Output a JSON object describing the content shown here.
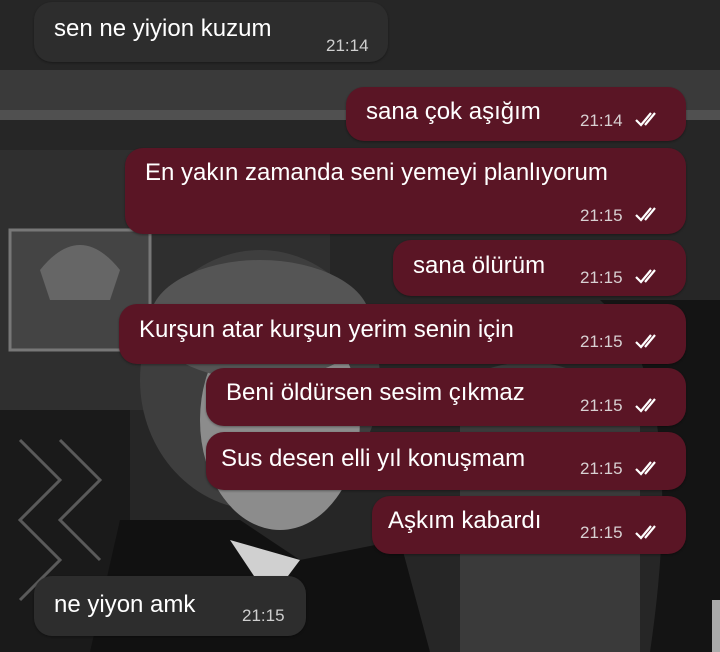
{
  "messages": [
    {
      "direction": "incoming",
      "text": "sen ne yiyion kuzum",
      "time": "21:14"
    },
    {
      "direction": "outgoing",
      "text": "sana çok aşığım",
      "time": "21:14",
      "status_icon": "double-check-icon"
    },
    {
      "direction": "outgoing",
      "text": "En yakın zamanda seni yemeyi planlıyorum",
      "time": "21:15",
      "status_icon": "double-check-icon"
    },
    {
      "direction": "outgoing",
      "text": "sana ölürüm",
      "time": "21:15",
      "status_icon": "double-check-icon"
    },
    {
      "direction": "outgoing",
      "text": "Kurşun atar kurşun yerim senin için",
      "time": "21:15",
      "status_icon": "double-check-icon"
    },
    {
      "direction": "outgoing",
      "text": "Beni öldürsen sesim çıkmaz",
      "time": "21:15",
      "status_icon": "double-check-icon"
    },
    {
      "direction": "outgoing",
      "text": "Sus desen elli yıl konuşmam",
      "time": "21:15",
      "status_icon": "double-check-icon"
    },
    {
      "direction": "outgoing",
      "text": "Aşkım kabardı",
      "time": "21:15",
      "status_icon": "double-check-icon"
    },
    {
      "direction": "incoming",
      "text": "ne yiyon amk",
      "time": "21:15"
    }
  ],
  "colors": {
    "outgoing_bubble": "#5a1525",
    "incoming_bubble": "#2d2d2d",
    "text": "#ffffff"
  }
}
